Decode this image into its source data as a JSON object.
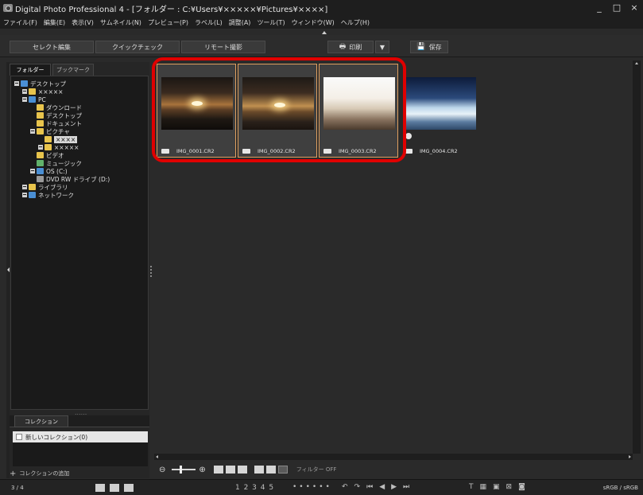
{
  "window": {
    "title": "Digital Photo Professional 4 - [フォルダー : C:¥Users¥×××××¥Pictures¥××××]",
    "controls": [
      "_",
      "□",
      "×"
    ]
  },
  "menu": [
    "ファイル(F)",
    "編集(E)",
    "表示(V)",
    "サムネイル(N)",
    "プレビュー(P)",
    "ラベル(L)",
    "調整(A)",
    "ツール(T)",
    "ウィンドウ(W)",
    "ヘルプ(H)"
  ],
  "toolbar": {
    "select_edit": "セレクト編集",
    "quick_check": "クイックチェック",
    "remote": "リモート撮影",
    "print": "印刷",
    "save": "保存"
  },
  "left_panel": {
    "tabs": [
      "フォルダー",
      "ブックマーク"
    ],
    "tree": [
      {
        "label": "デスクトップ",
        "icon": "blue"
      },
      {
        "label": "×××××",
        "icon": "yellow"
      },
      {
        "label": "PC",
        "icon": "blue"
      },
      {
        "label": "ダウンロード",
        "icon": "yellow"
      },
      {
        "label": "デスクトップ",
        "icon": "yellow"
      },
      {
        "label": "ドキュメント",
        "icon": "yellow"
      },
      {
        "label": "ピクチャ",
        "icon": "yellow"
      },
      {
        "label": "××××",
        "icon": "yellow"
      },
      {
        "label": "×××××",
        "icon": "yellow"
      },
      {
        "label": "ビデオ",
        "icon": "yellow"
      },
      {
        "label": "ミュージック",
        "icon": "green"
      },
      {
        "label": "OS (C:)",
        "icon": "blue"
      },
      {
        "label": "DVD RW ドライブ (D:)",
        "icon": "gray"
      },
      {
        "label": "ライブラリ",
        "icon": "yellow"
      },
      {
        "label": "ネットワーク",
        "icon": "blue"
      }
    ]
  },
  "collection": {
    "dots": "......",
    "tab": "コレクション",
    "item": "新しいコレクション(0)",
    "add": "コレクションの追加"
  },
  "thumbnails": [
    {
      "file": "IMG_0001.CR2",
      "style": "sunset1"
    },
    {
      "file": "IMG_0002.CR2",
      "style": "sunset2"
    },
    {
      "file": "IMG_0003.CR2",
      "style": "bright"
    },
    {
      "file": "IMG_0004.CR2",
      "style": "ice"
    }
  ],
  "bottom_bar": {
    "filter": "フィルター OFF"
  },
  "status": {
    "count": "3 / 4",
    "ratings": "1 2 3 4 5",
    "color_space": "sRGB / sRGB"
  },
  "colors": {
    "highlight": "#e00000",
    "selected_border": "#e0a060",
    "background": "#2a2a2a"
  }
}
